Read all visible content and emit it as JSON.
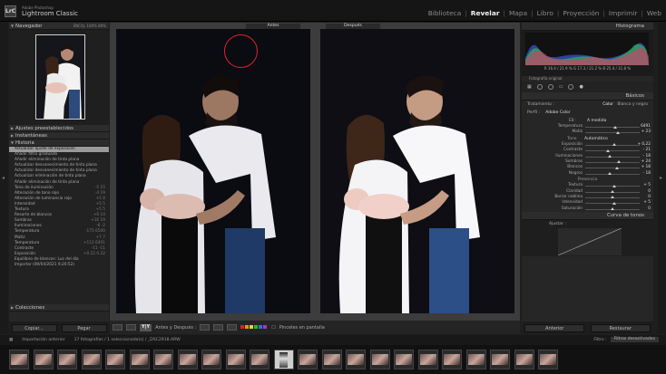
{
  "app": {
    "icon_text": "LrC",
    "brand_line1": "Adobe Photoshop",
    "brand_line2": "Lightroom Classic"
  },
  "modules": [
    {
      "label": "Biblioteca",
      "active": false
    },
    {
      "label": "Revelar",
      "active": true
    },
    {
      "label": "Mapa",
      "active": false
    },
    {
      "label": "Libro",
      "active": false
    },
    {
      "label": "Proyección",
      "active": false
    },
    {
      "label": "Imprimir",
      "active": false
    },
    {
      "label": "Web",
      "active": false
    }
  ],
  "left_panel": {
    "navigator_title": "Navegador",
    "navigator_opts": "ENCAJ.   100%   89%",
    "presets_title": "Ajustes preestablecidos",
    "snapshots_title": "Instantáneas",
    "history_title": "Historia",
    "history_items": [
      {
        "label": "Actualizar ajuste de exposición",
        "vals": "",
        "active": true
      },
      {
        "label": "Añadir filtro graduado",
        "vals": ""
      },
      {
        "label": "Añadir eliminación de tinta plana",
        "vals": ""
      },
      {
        "label": "Actualizar desvanecimiento de tinta plana",
        "vals": ""
      },
      {
        "label": "Actualizar desvanecimiento de tinta plana",
        "vals": ""
      },
      {
        "label": "Actualizar eliminación de tinta plana",
        "vals": ""
      },
      {
        "label": "Añadir eliminación de tinta plana",
        "vals": ""
      },
      {
        "label": "Tono de iluminación",
        "vals": "-5   15"
      },
      {
        "label": "Alteración de tono rojo",
        "vals": "-4   19"
      },
      {
        "label": "Alteración de luminancia rojo",
        "vals": "+5   8"
      },
      {
        "label": "Intensidad",
        "vals": "+5   5"
      },
      {
        "label": "Textura",
        "vals": "+5   5"
      },
      {
        "label": "Resorte de blancos",
        "vals": "+6   14"
      },
      {
        "label": "Sombras",
        "vals": "+16   19"
      },
      {
        "label": "Iluminaciones",
        "vals": "-6   -2"
      },
      {
        "label": "Temperatura",
        "vals": "-175   6500"
      },
      {
        "label": "Matiz",
        "vals": "+7   7"
      },
      {
        "label": "Temperatura",
        "vals": "+112   6491"
      },
      {
        "label": "Contraste",
        "vals": "-11   -11"
      },
      {
        "label": "Exposición",
        "vals": "+0.22   0.22"
      },
      {
        "label": "Equilibrio de blancos: Luz del día",
        "vals": ""
      },
      {
        "label": "Importar (09/04/2021 9:20:52)",
        "vals": ""
      }
    ],
    "collections_title": "Colecciones",
    "copy_btn": "Copiar...",
    "paste_btn": "Pegar"
  },
  "center": {
    "before_label": "Antes",
    "after_label": "Después",
    "toolbar_mode": "Y|Y",
    "toolbar_view": "Antes y Después :",
    "toolbar_hint": "Pinceles en pantalla"
  },
  "right_panel": {
    "histogram_title": "Histograma",
    "hist_stats": "R  16.4 / 21.9 %   G  17.3 / 21.2 %   B  25.4 / 31.8 %",
    "original_photo": "Fotografía original",
    "basic_title": "Básicos",
    "treatment_label": "Tratamiento :",
    "treatment_color": "Color",
    "treatment_bw": "Blanco y negro",
    "profile_label": "Perfil :",
    "profile_value": "Adobe Color",
    "wb_label": "EB :",
    "wb_value": "A medida",
    "tone_label": "Tono",
    "tone_auto": "Automático",
    "presence_label": "Presencia",
    "sliders_wb": [
      {
        "label": "Temperatura",
        "value": "6491",
        "pos": 0.55
      },
      {
        "label": "Matiz",
        "value": "+ 23",
        "pos": 0.6
      }
    ],
    "sliders_tone": [
      {
        "label": "Exposición",
        "value": "+ 0,22",
        "pos": 0.53
      },
      {
        "label": "Contraste",
        "value": "- 21",
        "pos": 0.42
      },
      {
        "label": "Iluminaciones",
        "value": "- 18",
        "pos": 0.45
      },
      {
        "label": "Sombras",
        "value": "+ 24",
        "pos": 0.62
      },
      {
        "label": "Blancos",
        "value": "+ 18",
        "pos": 0.58
      },
      {
        "label": "Negros",
        "value": "- 18",
        "pos": 0.45
      }
    ],
    "sliders_presence": [
      {
        "label": "Textura",
        "value": "+ 5",
        "pos": 0.53
      },
      {
        "label": "Claridad",
        "value": "0",
        "pos": 0.5
      },
      {
        "label": "Borrar neblina",
        "value": "0",
        "pos": 0.5
      },
      {
        "label": "Intensidad",
        "value": "+ 5",
        "pos": 0.53
      },
      {
        "label": "Saturación",
        "value": "0",
        "pos": 0.5
      }
    ],
    "tone_curve_title": "Curva de tonos",
    "adjust_label": "Ajustar :",
    "prev_btn": "Anterior",
    "reset_btn": "Restaurar"
  },
  "filmstrip": {
    "prev_import": "Importación anterior",
    "info": "17 fotografías / 1 seleccionada(s) / _DSC2918.ARW",
    "filter_label": "Filtro :",
    "filter_value": "Filtros desactivados",
    "thumb_count": 17,
    "selected_index": 11
  },
  "colors": {
    "accent_red": "#e0242b",
    "swatches": [
      "#d22",
      "#e90",
      "#dd2",
      "#2b2",
      "#27d",
      "#a3c"
    ]
  }
}
